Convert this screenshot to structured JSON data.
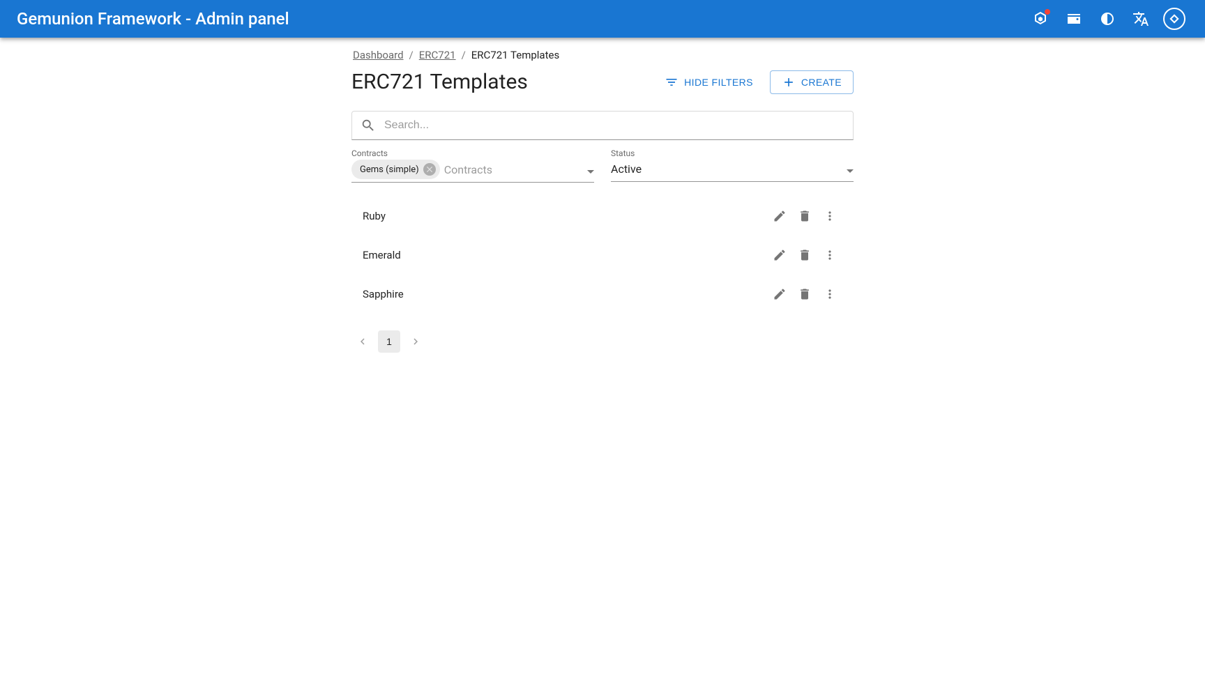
{
  "header": {
    "title": "Gemunion Framework - Admin panel"
  },
  "breadcrumb": {
    "items": [
      {
        "label": "Dashboard",
        "link": true
      },
      {
        "label": "ERC721",
        "link": true
      },
      {
        "label": "ERC721 Templates",
        "link": false
      }
    ]
  },
  "page": {
    "title": "ERC721 Templates",
    "hideFiltersLabel": "HIDE FILTERS",
    "createLabel": "CREATE"
  },
  "search": {
    "placeholder": "Search..."
  },
  "filters": {
    "contracts": {
      "label": "Contracts",
      "chip": "Gems (simple)",
      "placeholder": "Contracts"
    },
    "status": {
      "label": "Status",
      "value": "Active"
    }
  },
  "list": {
    "items": [
      {
        "name": "Ruby"
      },
      {
        "name": "Emerald"
      },
      {
        "name": "Sapphire"
      }
    ]
  },
  "pagination": {
    "current": "1"
  }
}
